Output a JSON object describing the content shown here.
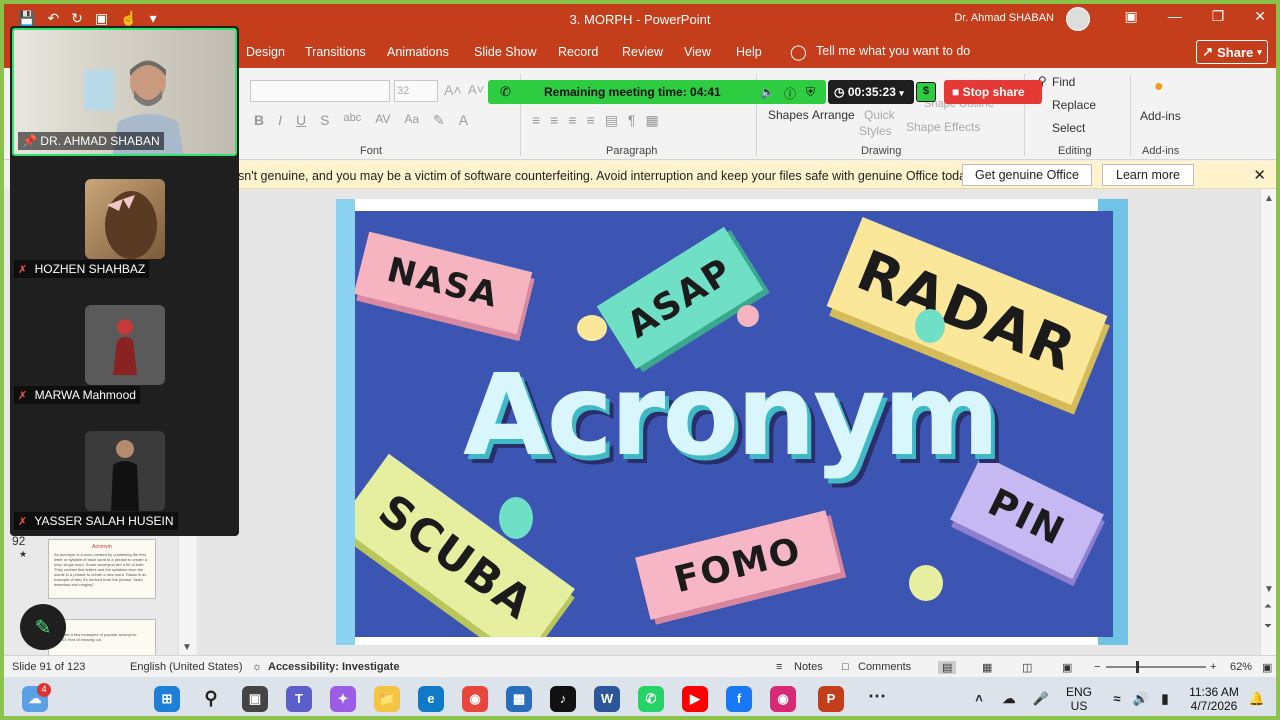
{
  "titlebar": {
    "doc_title": "3. MORPH  -  PowerPoint",
    "user_name": "Dr. Ahmad SHABAN"
  },
  "tabs": [
    "Design",
    "Transitions",
    "Animations",
    "Slide Show",
    "Record",
    "Review",
    "View",
    "Help"
  ],
  "tell_me": "Tell me what you want to do",
  "share_label": "Share",
  "ribbon": {
    "font_size": "32",
    "groups": {
      "font": "Font",
      "paragraph": "Paragraph",
      "drawing": "Drawing",
      "editing": "Editing",
      "addins": "Add-ins"
    },
    "shapes": "Shapes",
    "arrange": "Arrange",
    "quick_styles_1": "Quick",
    "quick_styles_2": "Styles",
    "shape_outline": "Shape Outline",
    "shape_effects": "Shape Effects",
    "find": "Find",
    "replace": "Replace",
    "select": "Select",
    "addins_btn": "Add-ins"
  },
  "meeting": {
    "remaining": "Remaining meeting time: 04:41",
    "timer": "00:35:23",
    "dollar": "$",
    "stop_share": "Stop share"
  },
  "warning": {
    "message": "sn't genuine, and you may be a victim of software counterfeiting. Avoid interruption and keep your files safe with genuine Office today.",
    "get_genuine": "Get genuine Office",
    "learn_more": "Learn more"
  },
  "thumbnails": {
    "slide_92_num": "92",
    "slide_92_title": "Acronym",
    "slide_92_body": "An acronym is a word created by combining the first letter or syllable of each word in a phrase to create a new, single word. Some acronyms are a bit of both. They contain first letters and the syllables from the words in a phrase to create a new word. Radar is an example of this; it's derived from the phrase \"radio detection and ranging\".",
    "slide_93_body": "Here are a few examples of popular acronyms: FOMO: fear of missing out."
  },
  "slide": {
    "acronym": "Acronym",
    "tags": {
      "nasa": "NASA",
      "asap": "ASAP",
      "radar": "RADAR",
      "pin": "PIN",
      "scuba": "SCUBA",
      "fomo": "FOMO"
    },
    "colors": {
      "background": "#3d55b2",
      "nasa": "#f6b3c0",
      "asap": "#6fe0c5",
      "radar": "#fbe79a",
      "pin": "#c6b8f2",
      "scuba": "#e6efa0",
      "fomo": "#f7b6c6"
    }
  },
  "participants": [
    {
      "name": "DR. AHMAD SHABAN",
      "pinned": true
    },
    {
      "name": "HOZHEN SHAHBAZ",
      "muted": true
    },
    {
      "name": "MARWA Mahmood",
      "muted": true
    },
    {
      "name": "YASSER  SALAH HUSEIN",
      "muted": true
    }
  ],
  "statusbar": {
    "slide_info": "Slide 91 of 123",
    "language": "English (United States)",
    "accessibility": "Accessibility: Investigate",
    "notes": "Notes",
    "comments": "Comments",
    "zoom": "62%"
  },
  "taskbar": {
    "weather_badge": "4",
    "lang_1": "ENG",
    "lang_2": "US",
    "time": "11:36 AM",
    "date": "4/7/2026"
  }
}
